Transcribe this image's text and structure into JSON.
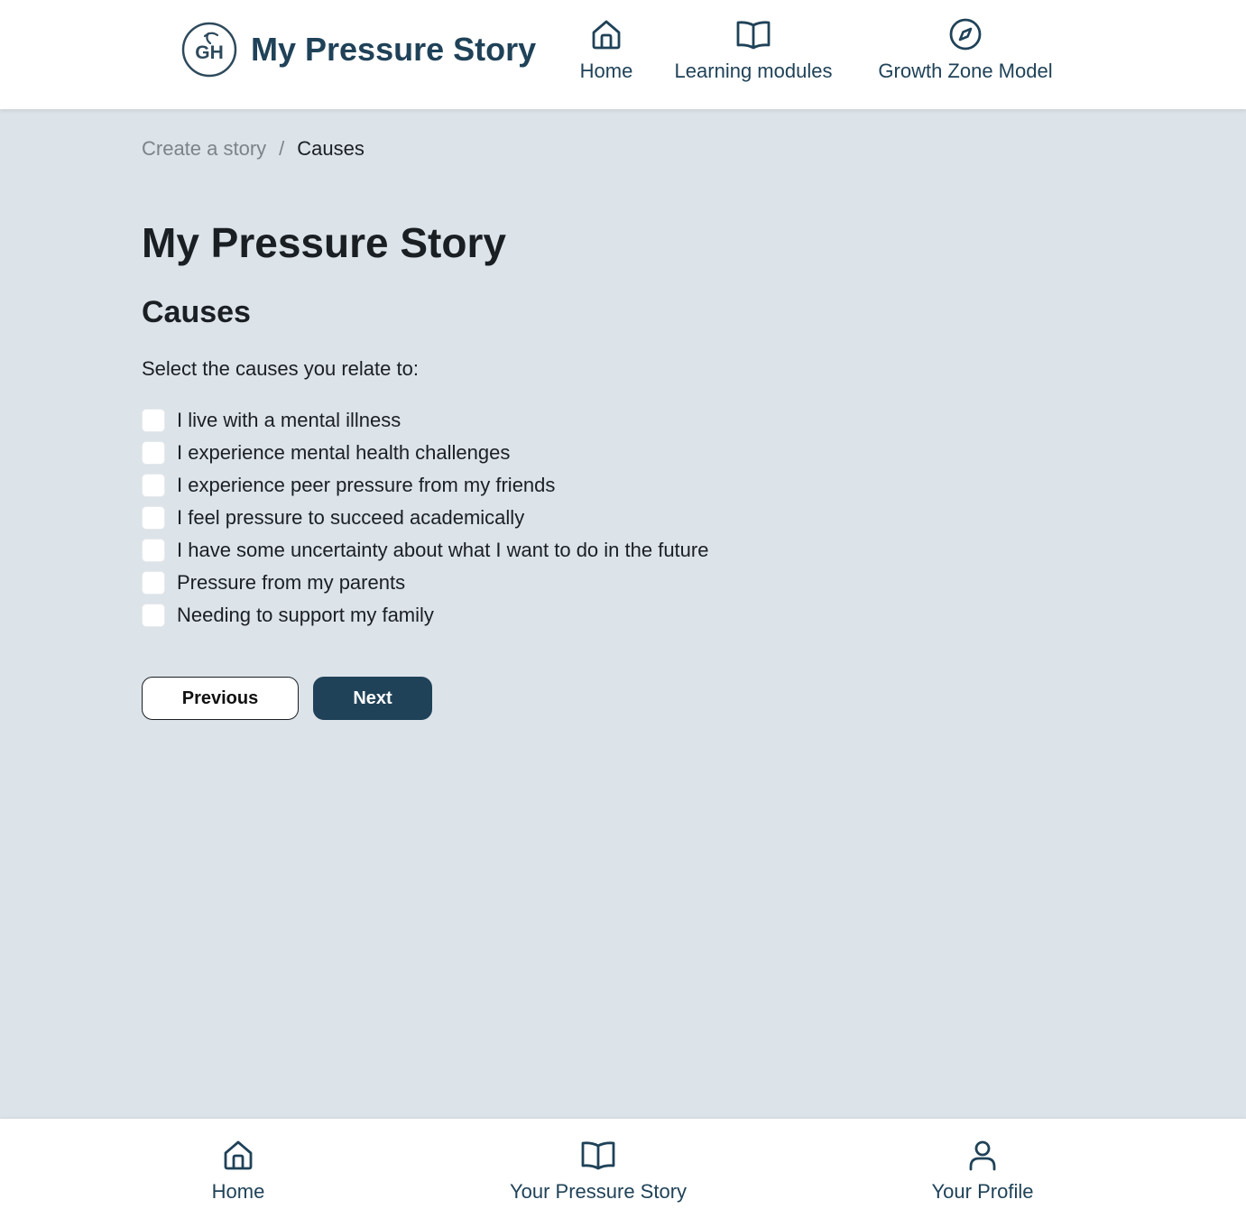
{
  "header": {
    "brand_title": "My Pressure Story",
    "logo_text": "GH",
    "nav": [
      {
        "label": "Home",
        "icon": "home-icon"
      },
      {
        "label": "Learning modules",
        "icon": "book-icon"
      },
      {
        "label": "Growth Zone Model",
        "icon": "compass-icon"
      }
    ]
  },
  "breadcrumb": {
    "parent": "Create a story",
    "separator": "/",
    "current": "Causes"
  },
  "main": {
    "title": "My Pressure Story",
    "section_title": "Causes",
    "prompt": "Select the causes you relate to:",
    "options": [
      {
        "label": "I live with a mental illness",
        "checked": false
      },
      {
        "label": "I experience mental health challenges",
        "checked": false
      },
      {
        "label": "I experience peer pressure from my friends",
        "checked": false
      },
      {
        "label": "I feel pressure to succeed academically",
        "checked": false
      },
      {
        "label": "I have some uncertainty about what I want to do in the future",
        "checked": false
      },
      {
        "label": "Pressure from my parents",
        "checked": false
      },
      {
        "label": "Needing to support my family",
        "checked": false
      }
    ],
    "buttons": {
      "previous": "Previous",
      "next": "Next"
    }
  },
  "bottom_nav": [
    {
      "label": "Home",
      "icon": "home-icon"
    },
    {
      "label": "Your Pressure Story",
      "icon": "book-icon"
    },
    {
      "label": "Your Profile",
      "icon": "user-icon"
    }
  ],
  "colors": {
    "brand": "#1f4258",
    "background": "#dce3e9",
    "surface": "#ffffff",
    "text": "#1a1f24",
    "muted": "#7c8389"
  }
}
